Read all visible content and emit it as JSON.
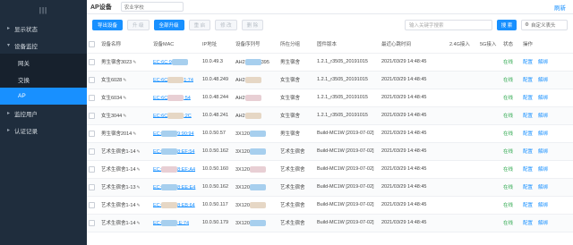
{
  "sidebar": {
    "top_icon": "menu-icon",
    "items": [
      {
        "label": "显示状态",
        "arrow": "▸"
      },
      {
        "label": "设备监控",
        "arrow": "▾"
      },
      {
        "label": "网关"
      },
      {
        "label": "交换"
      },
      {
        "label": "AP"
      },
      {
        "label": "监控用户",
        "arrow": "▸"
      },
      {
        "label": "认证记录",
        "arrow": "▸"
      }
    ]
  },
  "header": {
    "title": "AP设备",
    "school_select": "农业学校",
    "refresh": "刷新"
  },
  "toolbar": {
    "import_label": "导出设备",
    "upgrade_label": "升 级",
    "upgrade_all_label": "全部升级",
    "restart_label": "重 启",
    "modify_label": "修 改",
    "delete_label": "删 除",
    "search_placeholder": "输入关键字搜索",
    "search_label": "搜 索",
    "custom_columns_label": "自定义表头"
  },
  "table": {
    "headers": [
      "设备名称",
      "设备MAC",
      "IP地址",
      "设备序列号",
      "所在分组",
      "固件版本",
      "最近心跳时间",
      "2.4G接入",
      "5G接入",
      "状态",
      "操作"
    ],
    "rows": [
      {
        "name": "男生宿舍3023",
        "mac": "EC:6C:9",
        "mac_tail": "",
        "ip": "10.0.49.3",
        "serial": "AH2",
        "serial_tail": "395",
        "group": "男生宿舍",
        "firmware": "1.2.1_r3505_20191015",
        "heartbeat": "2021/03/29 14:48:45",
        "status": "在线",
        "blur": "blue"
      },
      {
        "name": "女生6028",
        "mac": "EC:6C",
        "mac_tail": "1:74",
        "ip": "10.0.48.249",
        "serial": "AH2",
        "serial_tail": "",
        "group": "女生宿舍",
        "firmware": "1.2.1_r3505_20191015",
        "heartbeat": "2021/03/29 14:48:45",
        "status": "在线",
        "blur": "tan"
      },
      {
        "name": "女生6034",
        "mac": "EC:6C",
        "mac_tail": ":54",
        "ip": "10.0.48.244",
        "serial": "AH2",
        "serial_tail": "",
        "group": "女生宿舍",
        "firmware": "1.2.1_r3505_20191015",
        "heartbeat": "2021/03/29 14:48:45",
        "status": "在线",
        "blur": "pink"
      },
      {
        "name": "女生3044",
        "mac": "EC:6C",
        "mac_tail": ":2C",
        "ip": "10.0.48.241",
        "serial": "AH2",
        "serial_tail": "",
        "group": "女生宿舍",
        "firmware": "1.2.1_r3505_20191015",
        "heartbeat": "2021/03/29 14:48:45",
        "status": "在线",
        "blur": "tan"
      },
      {
        "name": "男生宿舍2014",
        "mac": "EC:",
        "mac_tail": "9:90:94",
        "ip": "10.0.50.57",
        "serial": "3X120",
        "serial_tail": "",
        "group": "男生宿舍",
        "firmware": "Build-MC1W [2019-07-02]",
        "heartbeat": "2021/03/29 14:48:45",
        "status": "在线",
        "blur": "blue"
      },
      {
        "name": "艺术生宿舍1-14",
        "mac": "EC:",
        "mac_tail": "8:EF:54",
        "ip": "10.0.50.162",
        "serial": "3X120",
        "serial_tail": "",
        "group": "艺术生宿舍",
        "firmware": "Build-MC1W [2019-07-02]",
        "heartbeat": "2021/03/29 14:48:45",
        "status": "在线",
        "blur": "blue"
      },
      {
        "name": "艺术生宿舍1-14",
        "mac": "EC:",
        "mac_tail": "8:EF:A4",
        "ip": "10.0.50.160",
        "serial": "3X120",
        "serial_tail": "",
        "group": "艺术生宿舍",
        "firmware": "Build-MC1W [2019-07-02]",
        "heartbeat": "2021/03/29 14:48:45",
        "status": "在线",
        "blur": "pink"
      },
      {
        "name": "艺术生宿舍1-13",
        "mac": "EC:",
        "mac_tail": "8:EE:E4",
        "ip": "10.0.50.162",
        "serial": "3X120",
        "serial_tail": "",
        "group": "艺术生宿舍",
        "firmware": "Build-MC1W [2019-07-02]",
        "heartbeat": "2021/03/29 14:48:45",
        "status": "在线",
        "blur": "blue"
      },
      {
        "name": "艺术生宿舍1-14",
        "mac": "EC:",
        "mac_tail": "8:EB:64",
        "ip": "10.0.50.117",
        "serial": "3X120",
        "serial_tail": "",
        "group": "艺术生宿舍",
        "firmware": "Build-MC1W [2019-07-02]",
        "heartbeat": "2021/03/29 14:48:45",
        "status": "在线",
        "blur": "tan"
      },
      {
        "name": "艺术生宿舍1-14",
        "mac": "EC:",
        "mac_tail": ":E:74",
        "ip": "10.0.50.179",
        "serial": "3X120",
        "serial_tail": "",
        "group": "艺术生宿舍",
        "firmware": "Build-MC1W [2019-07-02]",
        "heartbeat": "2021/03/29 14:48:45",
        "status": "在线",
        "blur": "blue"
      }
    ],
    "op_config": "配置",
    "op_unbind": "解绑"
  },
  "colors": {
    "accent": "#1890ff",
    "sidebar_bg": "#1f2d3d",
    "online": "#2fa94f"
  }
}
